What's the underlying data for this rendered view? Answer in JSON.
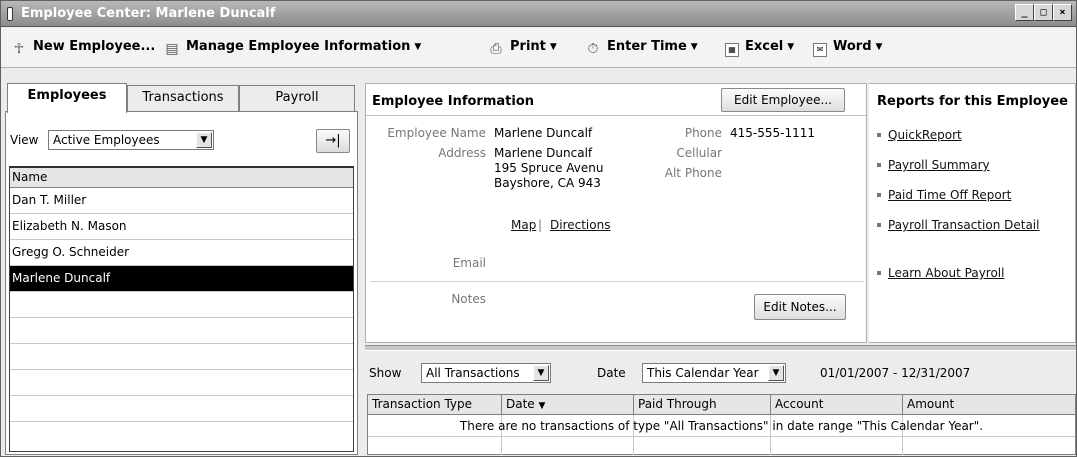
{
  "window": {
    "title": "Employee Center: Marlene Duncalf",
    "minimize": "_",
    "maximize": "□",
    "close": "×"
  },
  "toolbar": {
    "new_employee": "New Employee...",
    "manage": "Manage Employee Information",
    "print": "Print",
    "enter_time": "Enter Time",
    "excel": "Excel",
    "word": "Word"
  },
  "left": {
    "tabs": [
      "Employees",
      "Transactions",
      "Payroll"
    ],
    "view_label": "View",
    "view_value": "Active Employees",
    "list_header": "Name",
    "employees": [
      "Dan T. Miller",
      "Elizabeth N. Mason",
      "Gregg O. Schneider",
      "Marlene Duncalf"
    ],
    "selected_index": 3
  },
  "info": {
    "title": "Employee Information",
    "edit_button": "Edit Employee...",
    "name_label": "Employee Name",
    "name": "Marlene Duncalf",
    "address_label": "Address",
    "address_lines": [
      "Marlene Duncalf",
      "195 Spruce Avenu",
      "Bayshore, CA 943"
    ],
    "map": "Map",
    "divider": "|",
    "directions": "Directions",
    "email_label": "Email",
    "phone_label": "Phone",
    "phone": "415-555-1111",
    "cellular_label": "Cellular",
    "alt_phone_label": "Alt Phone",
    "notes_label": "Notes",
    "edit_notes_button": "Edit Notes..."
  },
  "reports": {
    "title": "Reports for this Employee",
    "items": [
      "QuickReport",
      "Payroll Summary",
      "Paid Time Off Report",
      "Payroll Transaction Detail",
      "Learn About Payroll"
    ]
  },
  "transactions": {
    "show_label": "Show",
    "show_value": "All Transactions",
    "date_label": "Date",
    "date_value": "This Calendar Year",
    "date_range": "01/01/2007 - 12/31/2007",
    "columns": [
      "Transaction Type",
      "Date",
      "Paid Through",
      "Account",
      "Amount"
    ],
    "empty_message": "There are no transactions of type \"All Transactions\" in date range \"This Calendar Year\"."
  }
}
